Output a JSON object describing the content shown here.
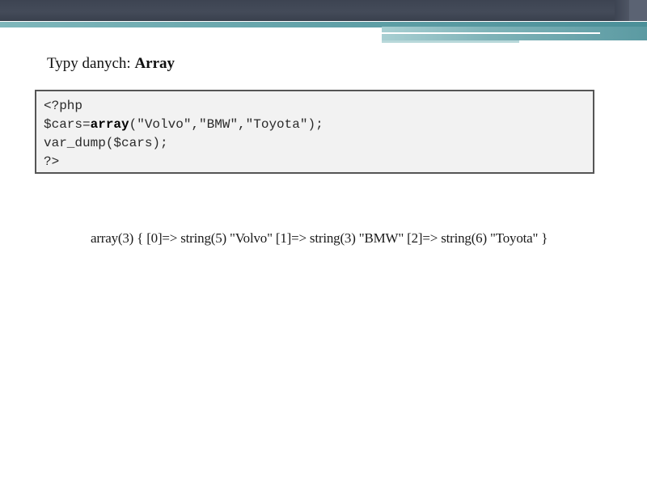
{
  "slide": {
    "title_prefix": "Typy danych: ",
    "title_bold": "Array",
    "code": {
      "line1": "<?php",
      "line2_var": "$cars=",
      "line2_keyword": "array",
      "line2_args": "(\"Volvo\",\"BMW\",\"Toyota\");",
      "line3": "var_dump($cars);",
      "line4": "?>"
    },
    "output": "array(3) { [0]=> string(5) \"Volvo\" [1]=> string(3) \"BMW\" [2]=> string(6) \"Toyota\" }"
  },
  "colors": {
    "header_dark": "#3d4452",
    "teal_accent": "#5f9fa6",
    "code_background": "#f2f2f2",
    "code_border": "#555555"
  }
}
